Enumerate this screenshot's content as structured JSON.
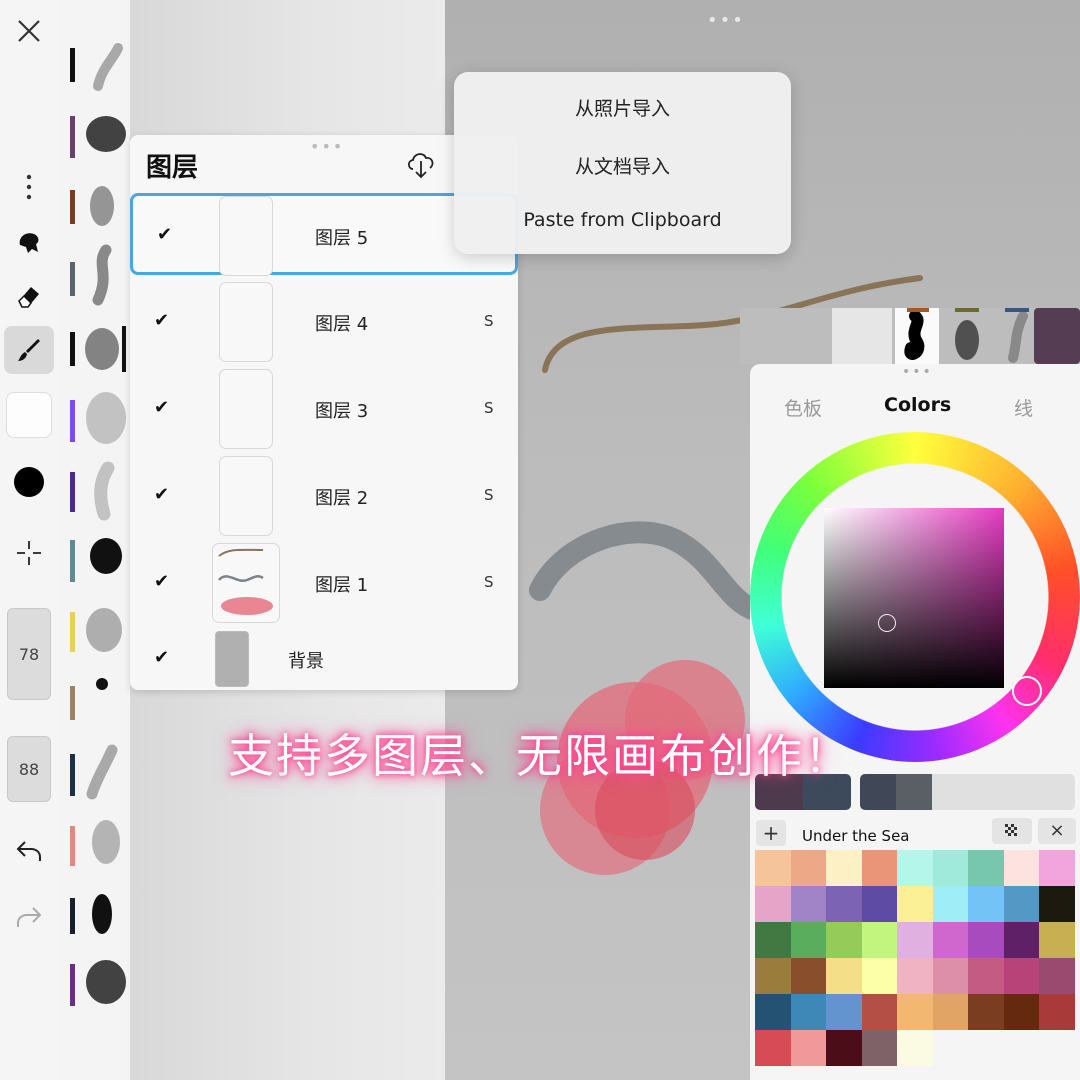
{
  "toolbar": {
    "size_value": "78",
    "opacity_value": "88"
  },
  "layers_panel": {
    "title": "图层",
    "layers": [
      {
        "name": "图层 5",
        "flag": "",
        "checked": "✔"
      },
      {
        "name": "图层 4",
        "flag": "S",
        "checked": "✔"
      },
      {
        "name": "图层 3",
        "flag": "S",
        "checked": "✔"
      },
      {
        "name": "图层 2",
        "flag": "S",
        "checked": "✔"
      },
      {
        "name": "图层 1",
        "flag": "S",
        "checked": "✔"
      },
      {
        "name": "背景",
        "flag": "",
        "checked": "✔"
      }
    ]
  },
  "import_menu": {
    "items": [
      "从照片导入",
      "从文档导入",
      "Paste from Clipboard"
    ]
  },
  "color_panel": {
    "tabs": [
      "色板",
      "Colors",
      "线"
    ],
    "active_tab": "Colors",
    "palette_name": "Under the Sea",
    "add_label": "+",
    "close_label": "×",
    "recent_colors": [
      "#4d3a4c",
      "#3c4a5c",
      "#404858",
      "#5a5f66"
    ],
    "palette": [
      "#f5c49a",
      "#eda887",
      "#fdf0c4",
      "#ea9577",
      "#b4f6ea",
      "#a0eadc",
      "#76c7ad",
      "#fde2df",
      "#f2a5dc",
      "#e6a5c8",
      "#a184c8",
      "#7d63b3",
      "#5e4ba3",
      "#fbf095",
      "#9fedf6",
      "#74c3f6",
      "#5498c5",
      "#1c190f",
      "#427841",
      "#59ad5c",
      "#95cb58",
      "#c1f57d",
      "#e0b0e0",
      "#d067cf",
      "#a84bbf",
      "#5f2067",
      "#c8b052",
      "#9a7c3c",
      "#894f2d",
      "#f4de88",
      "#fdfea8",
      "#f0b3c4",
      "#dd8ea8",
      "#c45b82",
      "#b84378",
      "#9a4a6e",
      "#235272",
      "#3d88b7",
      "#6494d0",
      "#b34f44",
      "#f2b771",
      "#e2a464",
      "#7b3d1f",
      "#65290f",
      "#a93a3a",
      "#d74b57",
      "#f1999a",
      "#4b0d17",
      "#7e6268",
      "#fbfbe4"
    ]
  },
  "banner": {
    "text": "支持多图层、无限画布创作！"
  },
  "colors": {
    "accent_blue": "#4aa6e0",
    "selected_hue_box": "#e63ac2"
  }
}
